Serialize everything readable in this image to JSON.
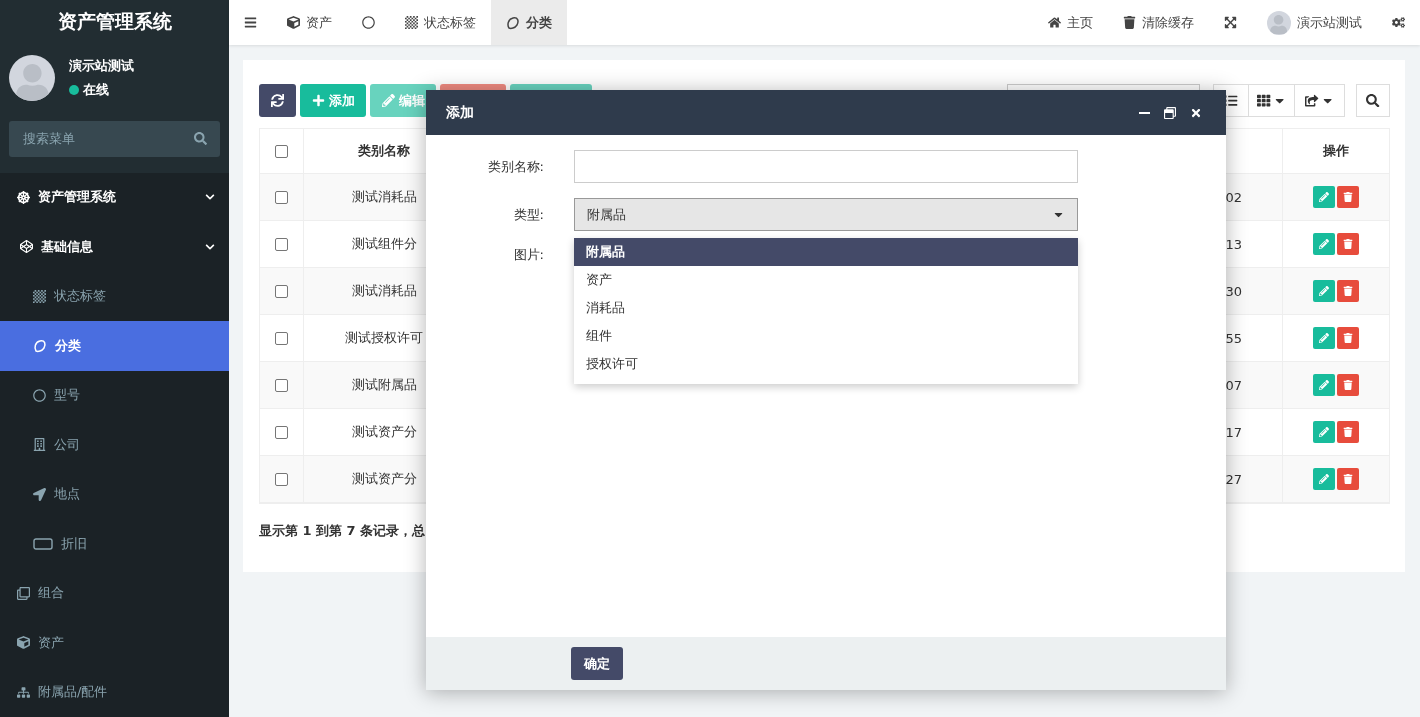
{
  "sidebar": {
    "title": "资产管理系统",
    "user": {
      "name": "演示站测试",
      "status": "在线",
      "online": true
    },
    "search": {
      "placeholder": "搜索菜单"
    },
    "menu": [
      {
        "label": "资产管理系统",
        "expanded": true,
        "selected": false,
        "children": [
          {
            "label": "基础信息",
            "expanded": true,
            "selected": false,
            "children": [
              {
                "label": "状态标签",
                "selected": false
              },
              {
                "label": "分类",
                "selected": true
              },
              {
                "label": "型号",
                "selected": false
              },
              {
                "label": "公司",
                "selected": false
              },
              {
                "label": "地点",
                "selected": false
              },
              {
                "label": "折旧",
                "selected": false
              }
            ]
          }
        ]
      },
      {
        "label": "组合",
        "selected": false
      },
      {
        "label": "资产",
        "selected": false
      },
      {
        "label": "附属品/配件",
        "selected": false
      }
    ]
  },
  "topbar": {
    "tabs": [
      {
        "label": "资产",
        "selected": false
      },
      {
        "selected": false
      },
      {
        "label": "状态标签",
        "selected": false
      },
      {
        "label": "分类",
        "selected": true
      }
    ],
    "links": [
      "主页",
      "清除缓存"
    ],
    "user": "演示站测试"
  },
  "toolbar": {
    "buttons": [
      {
        "kind": "refresh",
        "disabled": false
      },
      {
        "kind": "add",
        "label": "添加",
        "disabled": false
      },
      {
        "kind": "edit",
        "label": "编辑",
        "disabled": true
      },
      {
        "kind": "delete",
        "disabled": true
      },
      {
        "kind": "more",
        "disabled": true
      }
    ]
  },
  "table": {
    "columns": [
      {
        "label": "类别名称"
      },
      {
        "label": "操作"
      }
    ],
    "select_all": {
      "checked": false
    },
    "rows": [
      {
        "checked": false,
        "column_1": "测试消耗品",
        "column_2": "02"
      },
      {
        "checked": false,
        "column_1": "测试组件分",
        "column_2": "13"
      },
      {
        "checked": false,
        "column_1": "测试消耗品",
        "column_2": "30"
      },
      {
        "checked": false,
        "column_1": "测试授权许可",
        "column_2": "55"
      },
      {
        "checked": false,
        "column_1": "测试附属品",
        "column_2": "07"
      },
      {
        "checked": false,
        "column_1": "测试资产分",
        "column_2": "17"
      },
      {
        "checked": false,
        "column_1": "测试资产分",
        "column_2": "27"
      }
    ],
    "footer": "显示第 1 到第 7 条记录，总"
  },
  "dialog": {
    "title": "添加",
    "fields": [
      {
        "kind": "text",
        "label": "类别名称:"
      },
      {
        "kind": "select",
        "label": "类型:",
        "value": "附属品",
        "expanded": true,
        "options": [
          {
            "label": "附属品",
            "selected": true
          },
          {
            "label": "资产",
            "selected": false
          },
          {
            "label": "消耗品",
            "selected": false
          },
          {
            "label": "组件",
            "selected": false
          },
          {
            "label": "授权许可",
            "selected": false
          }
        ]
      },
      {
        "kind": "image",
        "label": "图片:"
      }
    ],
    "confirm": "确定"
  }
}
